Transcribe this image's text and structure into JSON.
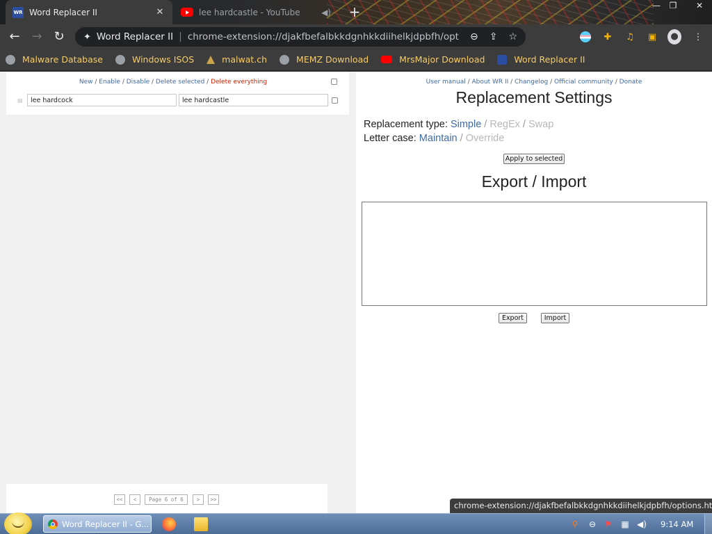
{
  "browser": {
    "tabs": [
      {
        "title": "Word Replacer II",
        "favicon": "WR",
        "active": true
      },
      {
        "title": "lee hardcastle - YouTube",
        "favicon": "youtube-icon",
        "active": false
      }
    ],
    "omnibox": {
      "site_label": "Word Replacer II",
      "url": "chrome-extension://djakfbefalbkkdgnhkkdiihelkjdpbfh/options.html#"
    },
    "bookmarks": [
      {
        "label": "Malware Database",
        "icon": "globe-icon"
      },
      {
        "label": "Windows ISOS",
        "icon": "globe-icon"
      },
      {
        "label": "malwat.ch",
        "icon": "malwatch-icon"
      },
      {
        "label": "MEMZ Download",
        "icon": "globe-icon"
      },
      {
        "label": "MrsMajor Download",
        "icon": "youtube-icon"
      },
      {
        "label": "Word Replacer II",
        "icon": "word-replacer-icon"
      }
    ],
    "status_url": "chrome-extension://djakfbefalbkkdgnhkkdiihelkjdpbfh/options.html#"
  },
  "left_panel": {
    "actions": {
      "new": "New",
      "enable": "Enable",
      "disable": "Disable",
      "delete_selected": "Delete selected",
      "delete_everything": "Delete everything",
      "separator": " / "
    },
    "rows": [
      {
        "find": "lee hardcock",
        "replace": "lee hardcastle"
      }
    ],
    "pager": {
      "first": "<<",
      "prev": "<",
      "page_text": "Page 6 of 6",
      "next": ">",
      "last": ">>"
    }
  },
  "right_panel": {
    "links": {
      "user_manual": "User manual",
      "about": "About WR II",
      "changelog": "Changelog",
      "community": "Official community",
      "donate": "Donate",
      "separator": " / "
    },
    "settings_title": "Replacement Settings",
    "replacement_type": {
      "label": "Replacement type:",
      "options": [
        "Simple",
        "RegEx",
        "Swap"
      ],
      "selected": "Simple"
    },
    "letter_case": {
      "label": "Letter case:",
      "options": [
        "Maintain",
        "Override"
      ],
      "selected": "Maintain"
    },
    "apply_button": "Apply to selected",
    "export_title": "Export / Import",
    "export_text": "",
    "export_button": "Export",
    "import_button": "Import"
  },
  "taskbar": {
    "active_window": "Word Replacer II - G...",
    "clock": "9:14 AM"
  },
  "colors": {
    "link": "#3f6aa4",
    "danger": "#cc2200",
    "disabled_option": "#b8b8b8",
    "bookmark_text": "#f8cc66",
    "chrome_frame": "#3c3c3c"
  }
}
